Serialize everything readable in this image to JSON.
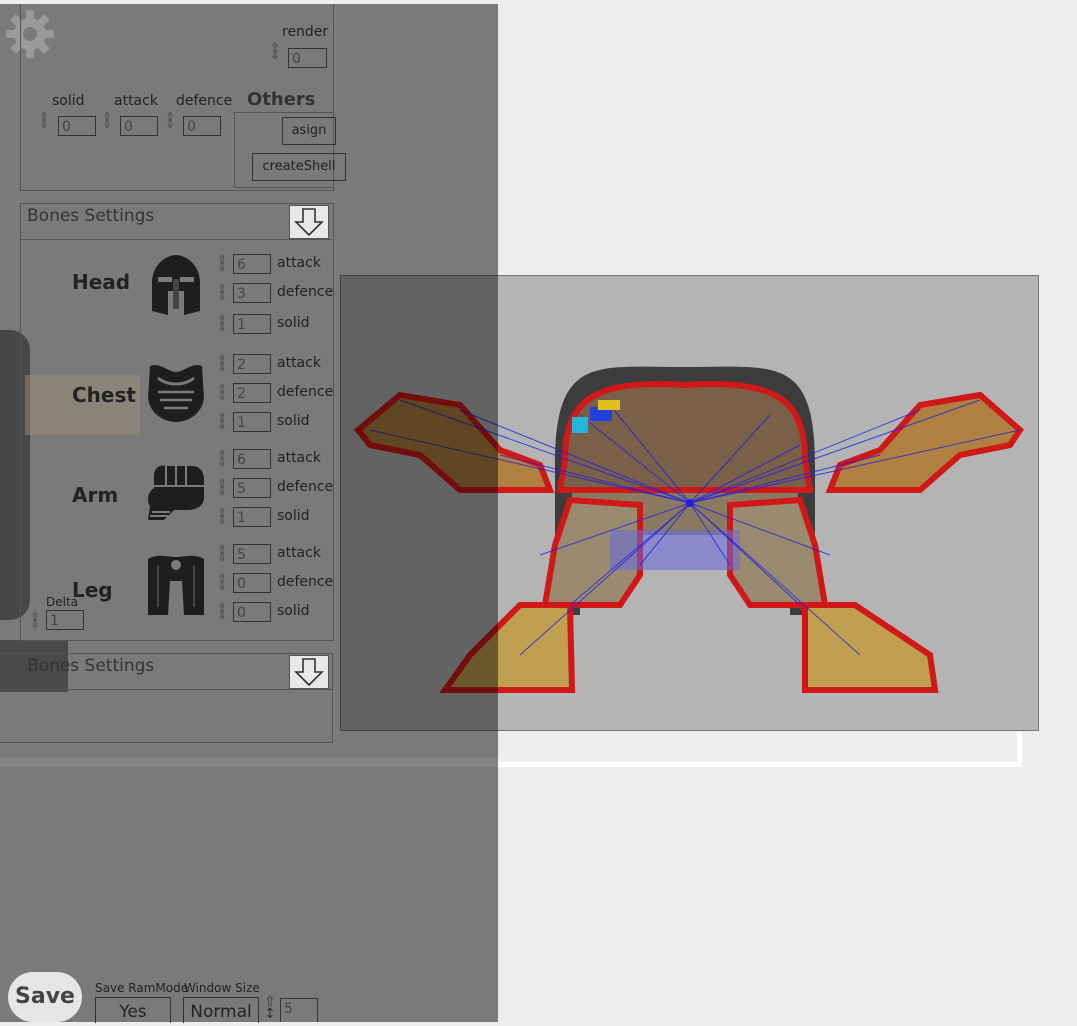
{
  "top_panel": {
    "render_label": "render",
    "render_value": "0",
    "solid_label": "solid",
    "attack_label": "attack",
    "defence_label": "defence",
    "solid_value": "0",
    "attack_value": "0",
    "defence_value": "0",
    "others_label": "Others",
    "asign_button": "asign",
    "create_shell_button": "createShell"
  },
  "bones_panel": {
    "title": "Bones Settings",
    "parts": [
      {
        "name": "Head",
        "icon": "helmet-icon",
        "attack": "6",
        "defence": "3",
        "solid": "1"
      },
      {
        "name": "Chest",
        "icon": "chest-armor-icon",
        "attack": "2",
        "defence": "2",
        "solid": "1"
      },
      {
        "name": "Arm",
        "icon": "gauntlet-icon",
        "attack": "6",
        "defence": "5",
        "solid": "1"
      },
      {
        "name": "Leg",
        "icon": "leg-armor-icon",
        "attack": "5",
        "defence": "0",
        "solid": "0"
      }
    ],
    "attack_label": "attack",
    "defence_label": "defence",
    "solid_label": "solid",
    "delta_label": "Delta",
    "delta_value": "1"
  },
  "bones_panel_2": {
    "title": "Bones Settings"
  },
  "bottom_bar": {
    "save_button": "Save",
    "save_ram_mode_label": "Save RamMode",
    "save_ram_mode_value": "Yes",
    "window_size_label": "Window Size",
    "window_size_value": "Normal",
    "extra_value": "5"
  },
  "colors": {
    "overlay": "#7a7a7a",
    "viewport": "#b4b4b4",
    "bone_outline": "#d01818",
    "bone_lines": "#2020e0"
  }
}
